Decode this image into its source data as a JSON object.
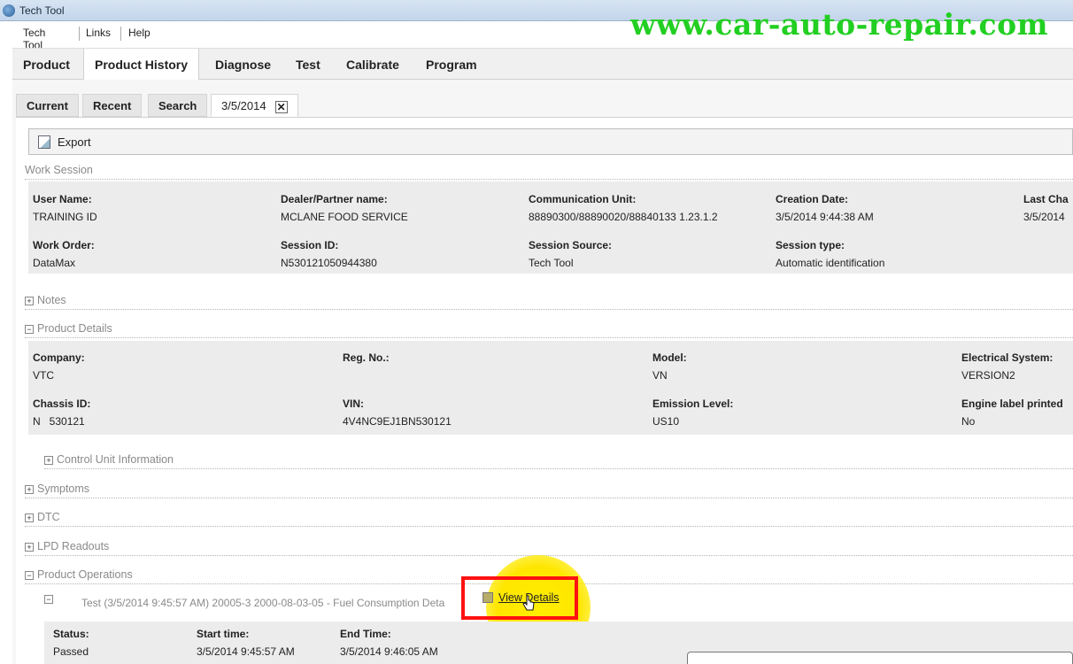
{
  "window": {
    "title": "Tech Tool"
  },
  "watermark": "www.car-auto-repair.com",
  "menu": {
    "items": [
      "Tech Tool",
      "Links",
      "Help"
    ]
  },
  "nav_tabs": [
    "Product",
    "Product History",
    "Diagnose",
    "Test",
    "Calibrate",
    "Program"
  ],
  "sub_tabs": [
    "Current",
    "Recent",
    "Search",
    "3/5/2014"
  ],
  "toolbar": {
    "export_label": "Export"
  },
  "work_session": {
    "heading": "Work Session",
    "fields": {
      "user_name_label": "User Name:",
      "user_name": "TRAINING ID",
      "dealer_label": "Dealer/Partner name:",
      "dealer": "MCLANE FOOD SERVICE",
      "comm_unit_label": "Communication Unit:",
      "comm_unit": "88890300/88890020/88840133 1.23.1.2",
      "creation_date_label": "Creation Date:",
      "creation_date": "3/5/2014 9:44:38 AM",
      "last_changed_label": "Last Cha",
      "last_changed": "3/5/2014",
      "work_order_label": "Work Order:",
      "work_order": "DataMax",
      "session_id_label": "Session ID:",
      "session_id": "N530121050944380",
      "session_source_label": "Session Source:",
      "session_source": "Tech Tool",
      "session_type_label": "Session type:",
      "session_type": "Automatic identification"
    }
  },
  "notes": {
    "heading": "Notes"
  },
  "product_details": {
    "heading": "Product Details",
    "fields": {
      "company_label": "Company:",
      "company": "VTC",
      "reg_no_label": "Reg. No.:",
      "reg_no": "",
      "model_label": "Model:",
      "model": "VN",
      "electrical_label": "Electrical System:",
      "electrical": "VERSION2",
      "chassis_label": "Chassis ID:",
      "chassis": "N   530121",
      "vin_label": "VIN:",
      "vin": "4V4NC9EJ1BN530121",
      "emission_label": "Emission Level:",
      "emission": "US10",
      "engine_label_label": "Engine label printed",
      "engine_label": "No"
    }
  },
  "control_unit_info": {
    "heading": "Control Unit Information"
  },
  "symptoms": {
    "heading": "Symptoms"
  },
  "dtc": {
    "heading": "DTC"
  },
  "lpd_readouts": {
    "heading": "LPD Readouts"
  },
  "product_operations": {
    "heading": "Product Operations",
    "operation_label": "Test (3/5/2014 9:45:57 AM) 20005-3 2000-08-03-05 - Fuel Consumption Deta",
    "view_details": "View Details",
    "status_label": "Status:",
    "status": "Passed",
    "start_label": "Start time:",
    "start": "3/5/2014 9:45:57 AM",
    "end_label": "End Time:",
    "end": "3/5/2014 9:46:05 AM"
  },
  "colors": {
    "watermark": "#22cf22",
    "highlight": "#ffe600",
    "red_box": "#ff1111"
  },
  "icons": [
    "app-icon",
    "export-icon",
    "close-icon",
    "expand-icon",
    "collapse-icon",
    "view-details-icon",
    "hand-cursor-icon"
  ]
}
